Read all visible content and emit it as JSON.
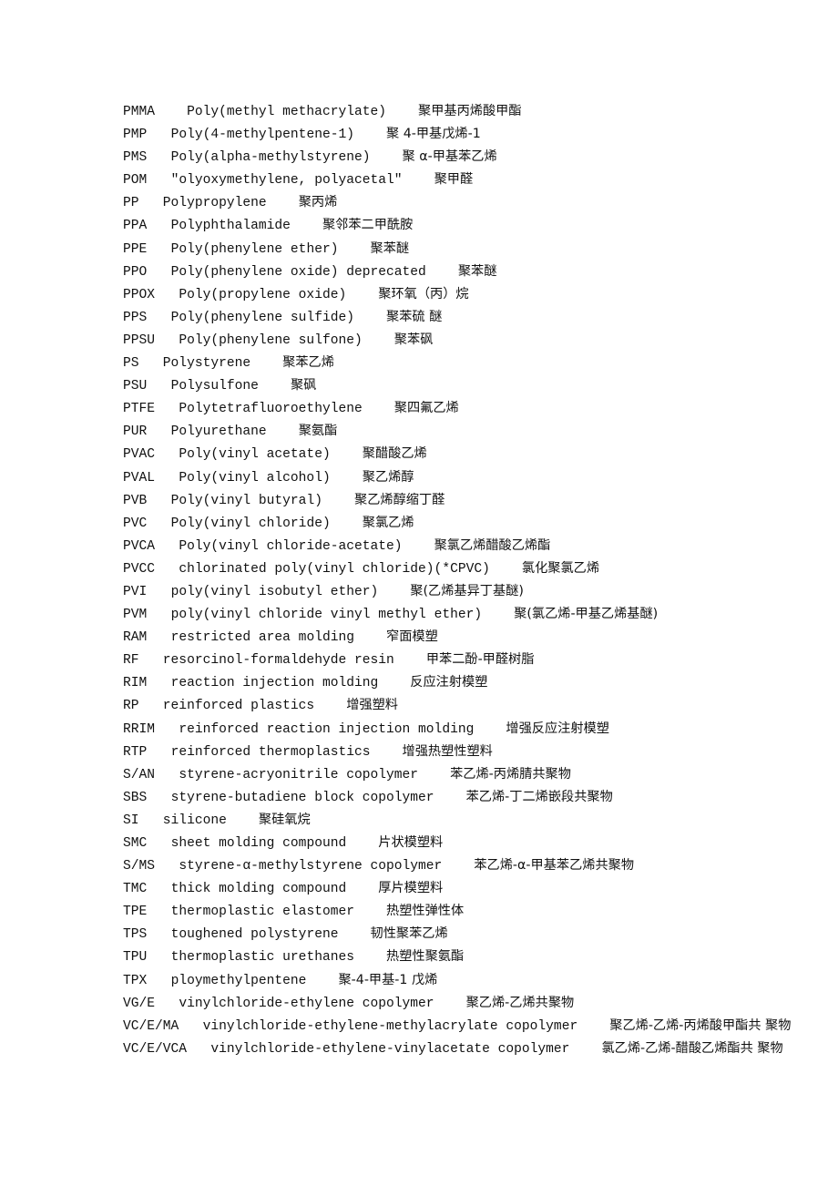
{
  "document": {
    "type": "glossary",
    "title": "Plastics abbreviation glossary (English / Chinese)",
    "language": "en-zh",
    "entries": [
      {
        "abbr": "PMMA",
        "gap1": "    ",
        "eng": "Poly(methyl methacrylate)",
        "gap2": "    ",
        "cn": "聚甲基丙烯酸甲酯"
      },
      {
        "abbr": "PMP",
        "gap1": "   ",
        "eng": "Poly(4-methylpentene-1)",
        "gap2": "    ",
        "cn": "聚 4-甲基戊烯-1"
      },
      {
        "abbr": "PMS",
        "gap1": "   ",
        "eng": "Poly(alpha-methylstyrene)",
        "gap2": "    ",
        "cn": "聚 α-甲基苯乙烯"
      },
      {
        "abbr": "POM",
        "gap1": "   ",
        "eng": "″olyoxymethylene, polyacetal″",
        "gap2": "    ",
        "cn": "聚甲醛"
      },
      {
        "abbr": "PP",
        "gap1": "   ",
        "eng": "Polypropylene",
        "gap2": "    ",
        "cn": "聚丙烯"
      },
      {
        "abbr": "PPA",
        "gap1": "   ",
        "eng": "Polyphthalamide",
        "gap2": "    ",
        "cn": "聚邻苯二甲酰胺"
      },
      {
        "abbr": "PPE",
        "gap1": "   ",
        "eng": "Poly(phenylene ether)",
        "gap2": "    ",
        "cn": "聚苯醚"
      },
      {
        "abbr": "PPO",
        "gap1": "   ",
        "eng": "Poly(phenylene oxide) deprecated",
        "gap2": "    ",
        "cn": "聚苯醚"
      },
      {
        "abbr": "PPOX",
        "gap1": "   ",
        "eng": "Poly(propylene oxide)",
        "gap2": "    ",
        "cn": "聚环氧（丙）烷"
      },
      {
        "abbr": "PPS",
        "gap1": "   ",
        "eng": "Poly(phenylene sulfide)",
        "gap2": "    ",
        "cn": "聚苯硫 醚"
      },
      {
        "abbr": "PPSU",
        "gap1": "   ",
        "eng": "Poly(phenylene sulfone)",
        "gap2": "    ",
        "cn": "聚苯砜"
      },
      {
        "abbr": "PS",
        "gap1": "   ",
        "eng": "Polystyrene",
        "gap2": "    ",
        "cn": "聚苯乙烯"
      },
      {
        "abbr": "PSU",
        "gap1": "   ",
        "eng": "Polysulfone",
        "gap2": "    ",
        "cn": "聚砜"
      },
      {
        "abbr": "PTFE",
        "gap1": "   ",
        "eng": "Polytetrafluoroethylene",
        "gap2": "    ",
        "cn": "聚四氟乙烯"
      },
      {
        "abbr": "PUR",
        "gap1": "   ",
        "eng": "Polyurethane",
        "gap2": "    ",
        "cn": "聚氨酯"
      },
      {
        "abbr": "PVAC",
        "gap1": "   ",
        "eng": "Poly(vinyl acetate)",
        "gap2": "    ",
        "cn": "聚醋酸乙烯"
      },
      {
        "abbr": "PVAL",
        "gap1": "   ",
        "eng": "Poly(vinyl alcohol)",
        "gap2": "    ",
        "cn": "聚乙烯醇"
      },
      {
        "abbr": "PVB",
        "gap1": "   ",
        "eng": "Poly(vinyl butyral)",
        "gap2": "    ",
        "cn": "聚乙烯醇缩丁醛"
      },
      {
        "abbr": "PVC",
        "gap1": "   ",
        "eng": "Poly(vinyl chloride)",
        "gap2": "    ",
        "cn": "聚氯乙烯"
      },
      {
        "abbr": "PVCA",
        "gap1": "   ",
        "eng": "Poly(vinyl chloride-acetate)",
        "gap2": "    ",
        "cn": "聚氯乙烯醋酸乙烯酯"
      },
      {
        "abbr": "PVCC",
        "gap1": "   ",
        "eng": "chlorinated poly(vinyl chloride)(*CPVC)",
        "gap2": "    ",
        "cn": "氯化聚氯乙烯"
      },
      {
        "abbr": "PVI",
        "gap1": "   ",
        "eng": "poly(vinyl isobutyl ether)",
        "gap2": "    ",
        "cn": "聚(乙烯基异丁基醚)"
      },
      {
        "abbr": "PVM",
        "gap1": "   ",
        "eng": "poly(vinyl chloride vinyl methyl ether)",
        "gap2": "    ",
        "cn": "聚(氯乙烯-甲基乙烯基醚)"
      },
      {
        "abbr": "RAM",
        "gap1": "   ",
        "eng": "restricted area molding",
        "gap2": "    ",
        "cn": "窄面模塑"
      },
      {
        "abbr": "RF",
        "gap1": "   ",
        "eng": "resorcinol-formaldehyde resin",
        "gap2": "    ",
        "cn": "甲苯二酚-甲醛树脂"
      },
      {
        "abbr": "RIM",
        "gap1": "   ",
        "eng": "reaction injection molding",
        "gap2": "    ",
        "cn": "反应注射模塑"
      },
      {
        "abbr": "RP",
        "gap1": "   ",
        "eng": "reinforced plastics",
        "gap2": "    ",
        "cn": "增强塑料"
      },
      {
        "abbr": "RRIM",
        "gap1": "   ",
        "eng": "reinforced reaction injection molding",
        "gap2": "    ",
        "cn": "增强反应注射模塑"
      },
      {
        "abbr": "RTP",
        "gap1": "   ",
        "eng": "reinforced thermoplastics",
        "gap2": "    ",
        "cn": "增强热塑性塑料"
      },
      {
        "abbr": "S/AN",
        "gap1": "   ",
        "eng": "styrene-acryonitrile copolymer",
        "gap2": "    ",
        "cn": "苯乙烯-丙烯腈共聚物"
      },
      {
        "abbr": "SBS",
        "gap1": "   ",
        "eng": "styrene-butadiene block copolymer",
        "gap2": "    ",
        "cn": "苯乙烯-丁二烯嵌段共聚物"
      },
      {
        "abbr": "SI",
        "gap1": "   ",
        "eng": "silicone",
        "gap2": "    ",
        "cn": "聚硅氧烷"
      },
      {
        "abbr": "SMC",
        "gap1": "   ",
        "eng": "sheet molding compound",
        "gap2": "    ",
        "cn": "片状模塑料"
      },
      {
        "abbr": "S/MS",
        "gap1": "   ",
        "eng": "styrene-α-methylstyrene copolymer",
        "gap2": "    ",
        "cn": "苯乙烯-α-甲基苯乙烯共聚物"
      },
      {
        "abbr": "TMC",
        "gap1": "   ",
        "eng": "thick molding compound",
        "gap2": "    ",
        "cn": "厚片模塑料"
      },
      {
        "abbr": "TPE",
        "gap1": "   ",
        "eng": "thermoplastic elastomer",
        "gap2": "    ",
        "cn": "热塑性弹性体"
      },
      {
        "abbr": "TPS",
        "gap1": "   ",
        "eng": "toughened polystyrene",
        "gap2": "    ",
        "cn": "韧性聚苯乙烯"
      },
      {
        "abbr": "TPU",
        "gap1": "   ",
        "eng": "thermoplastic urethanes",
        "gap2": "    ",
        "cn": "热塑性聚氨酯"
      },
      {
        "abbr": "TPX",
        "gap1": "   ",
        "eng": "ploymethylpentene",
        "gap2": "    ",
        "cn": "聚-4-甲基-1 戊烯"
      },
      {
        "abbr": "VG/E",
        "gap1": "   ",
        "eng": "vinylchloride-ethylene copolymer",
        "gap2": "    ",
        "cn": "聚乙烯-乙烯共聚物"
      },
      {
        "abbr": "VC/E/MA",
        "gap1": "   ",
        "eng": "vinylchloride-ethylene-methylacrylate copolymer",
        "gap2": "    ",
        "cn": "聚乙烯-乙烯-丙烯酸甲酯共 聚物"
      },
      {
        "abbr": "VC/E/VCA",
        "gap1": "   ",
        "eng": "vinylchloride-ethylene-vinylacetate copolymer",
        "gap2": "    ",
        "cn": "氯乙烯-乙烯-醋酸乙烯酯共 聚物"
      }
    ]
  }
}
